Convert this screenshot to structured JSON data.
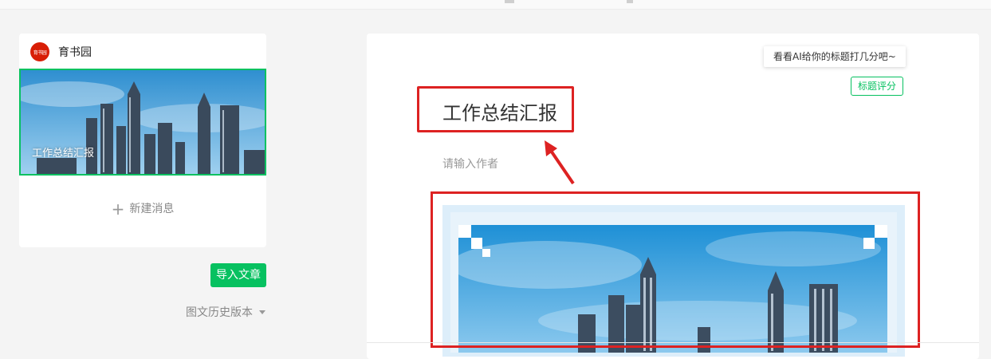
{
  "account": {
    "logo_text": "育书园",
    "name": "育书园"
  },
  "sidebar": {
    "article_title": "工作总结汇报",
    "new_message_label": "新建消息",
    "import_button": "导入文章",
    "history_label": "图文历史版本"
  },
  "editor": {
    "ai_hint": "看看AI给你的标题打几分吧~",
    "score_button": "标题评分",
    "title": "工作总结汇报",
    "author_placeholder": "请输入作者"
  },
  "colors": {
    "accent": "#07c160",
    "annotation": "#dd2222",
    "logo": "#d81e06"
  }
}
